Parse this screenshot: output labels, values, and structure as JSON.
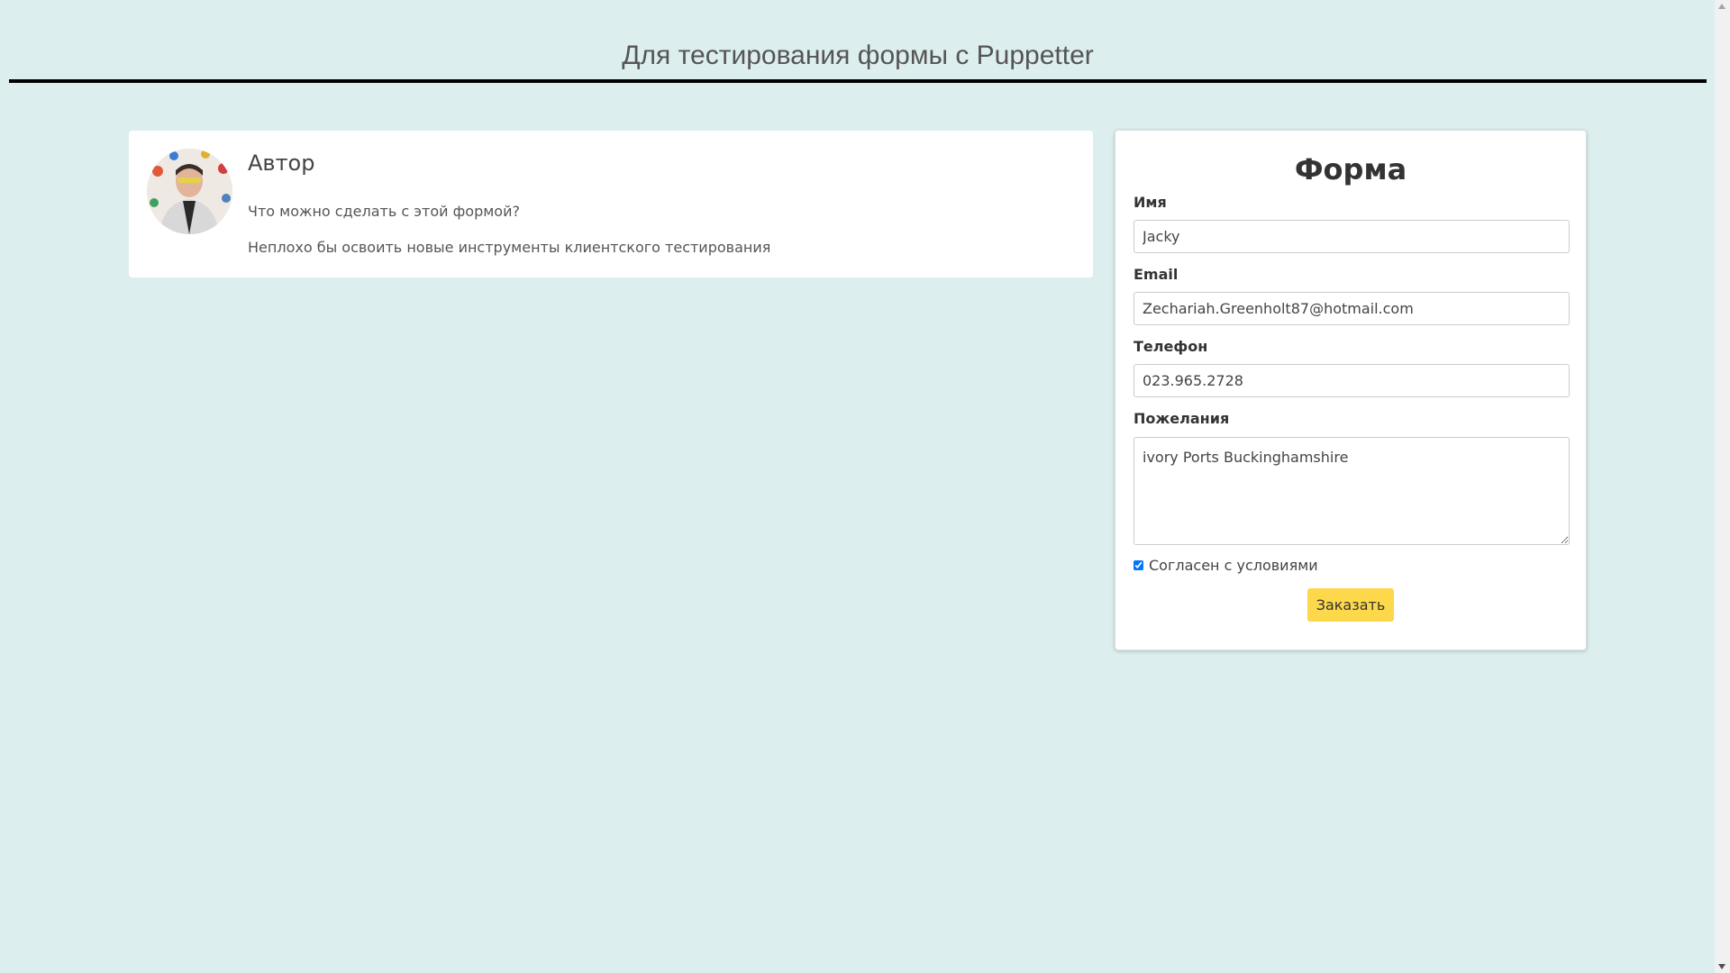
{
  "header": {
    "title": "Для тестирования формы с Puppetter"
  },
  "author": {
    "title": "Автор",
    "line1": "Что можно сделать с этой формой?",
    "line2": "Неплохо бы освоить новые инструменты клиентского тестирования"
  },
  "form": {
    "title": "Форма",
    "name_label": "Имя",
    "name_value": "Jacky",
    "email_label": "Email",
    "email_value": "Zechariah.Greenholt87@hotmail.com",
    "phone_label": "Телефон",
    "phone_value": "023.965.2728",
    "wishes_label": "Пожелания",
    "wishes_value": "ivory Ports Buckinghamshire",
    "agree_label": "Согласен с условиями",
    "agree_checked": true,
    "submit_label": "Заказать"
  },
  "colors": {
    "background": "#ddeeee",
    "button": "#fdd84a"
  }
}
